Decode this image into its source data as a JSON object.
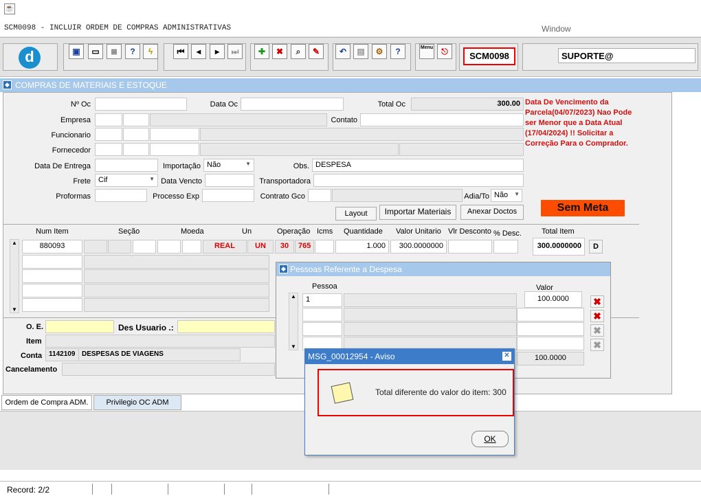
{
  "window": {
    "title": "SCM0098 - INCLUIR ORDEM DE COMPRAS ADMINISTRATIVAS",
    "menu_window": "Window"
  },
  "toolbar": {
    "module_code": "SCM0098",
    "user": "SUPORTE@",
    "menu_icon_label": "Menu"
  },
  "section": {
    "title": "COMPRAS DE MATERIAIS E ESTOQUE"
  },
  "form": {
    "labels": {
      "num_oc": "Nº Oc",
      "data_oc": "Data Oc",
      "total_oc": "Total Oc",
      "empresa": "Empresa",
      "contato": "Contato",
      "funcionario": "Funcionario",
      "fornecedor": "Fornecedor",
      "data_entrega": "Data De Entrega",
      "importacao": "Importação",
      "obs": "Obs.",
      "frete": "Frete",
      "data_vencto": "Data Vencto",
      "transportadora": "Transportadora",
      "proformas": "Proformas",
      "processo_exp": "Processo Exp",
      "contrato_gco": "Contrato Gco",
      "adia_to": "Adia/To"
    },
    "values": {
      "total_oc": "300.00",
      "importacao": "Não",
      "obs": "DESPESA",
      "frete": "Cif",
      "adia_to": "Não"
    },
    "error_message": "Data De Vencimento da Parcela(04/07/2023) Nao Pode ser Menor que a Data Atual (17/04/2024) !! Solicitar a Correção Para o Comprador.",
    "buttons": {
      "layout": "Layout",
      "importar": "Importar Materiais",
      "anexar": "Anexar Doctos",
      "sem_meta": "Sem Meta"
    }
  },
  "items_grid": {
    "headers": {
      "num_item": "Num Item",
      "secao": "Seção",
      "moeda": "Moeda",
      "un": "Un",
      "operacao": "Operação",
      "icms": "Icms",
      "quantidade": "Quantidade",
      "valor_unitario": "Valor Unitario",
      "vlr_desconto": "Vlr Desconto",
      "pct_desc": "% Desc.",
      "total_item": "Total Item"
    },
    "row": {
      "num_item": "880093",
      "moeda": "REAL",
      "un": "UN",
      "op1": "30",
      "op2": "765",
      "quantidade": "1.000",
      "valor_unitario": "300.0000000",
      "total_item": "300.0000000",
      "d_button": "D"
    }
  },
  "lower": {
    "oe_label": "O. E.",
    "des_usuario_label": "Des Usuario .:",
    "item_label": "Item",
    "conta_label": "Conta",
    "conta_code": "1142109",
    "conta_desc": "DESPESAS DE VIAGENS",
    "cancelamento_label": "Cancelamento"
  },
  "tabs": [
    "Ordem de Compra ADM.",
    "Privilegio OC ADM"
  ],
  "pessoas_dialog": {
    "title": "Pessoas Referente a Despesa",
    "col_pessoa": "Pessoa",
    "col_valor": "Valor",
    "row_pessoa": "1",
    "row_valor": "100.0000",
    "total": "100.0000"
  },
  "alert_dialog": {
    "title": "MSG_00012954 - Aviso",
    "message": "Total diferente do valor do item: 300",
    "ok": "OK"
  },
  "status": {
    "record": "Record: 2/2"
  }
}
